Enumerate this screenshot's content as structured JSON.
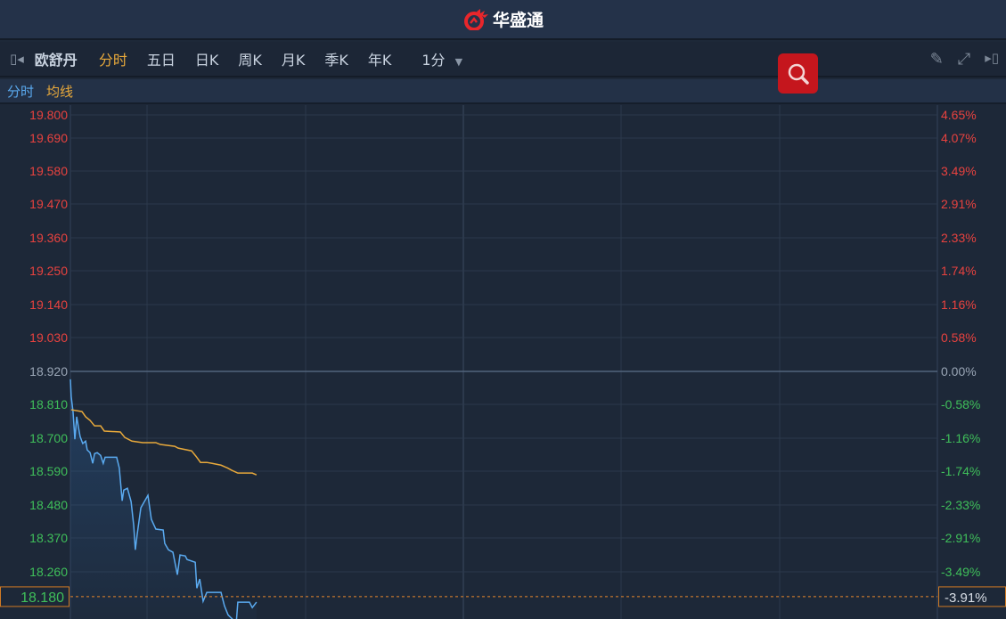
{
  "app": {
    "title": "华盛通"
  },
  "toolbar": {
    "stock_name": "欧舒丹",
    "tabs": [
      "分时",
      "五日",
      "日K",
      "周K",
      "月K",
      "季K",
      "年K"
    ],
    "active_tab": "分时",
    "interval": "1分"
  },
  "legend": {
    "price_label": "分时",
    "avg_label": "均线"
  },
  "colors": {
    "up": "#e8423f",
    "down": "#3fbf5a",
    "neutral": "#9aa6b6",
    "price_line": "#5aaaf0",
    "avg_line": "#e8a93b",
    "accent": "#c5161d"
  },
  "chart_data": {
    "type": "line",
    "prev_close": 18.92,
    "left_ticks": [
      "19.800",
      "19.690",
      "19.580",
      "19.470",
      "19.360",
      "19.250",
      "19.140",
      "19.030",
      "18.920",
      "18.810",
      "18.700",
      "18.590",
      "18.480",
      "18.370",
      "18.260"
    ],
    "right_ticks": [
      "4.65%",
      "4.07%",
      "3.49%",
      "2.91%",
      "2.33%",
      "1.74%",
      "1.16%",
      "0.58%",
      "0.00%",
      "-0.58%",
      "-1.16%",
      "-1.74%",
      "-2.33%",
      "-2.91%",
      "-3.49%"
    ],
    "current_price": "18.180",
    "current_change": "-3.91%",
    "current_value": 18.18,
    "series": [
      {
        "name": "分时",
        "t": [
          0,
          0.3,
          1,
          1.7,
          2.4,
          3.1,
          3.7,
          4.7,
          5.8,
          6.4,
          7.5,
          8.5,
          9.2,
          10.2,
          11.5,
          12.5,
          13.2,
          14.2,
          17.6,
          18.6,
          19.7,
          20.3,
          21.7,
          23.1,
          24.1,
          24.7,
          25.4,
          26.8,
          29.5,
          30.8,
          32.5,
          35.3,
          35.9,
          37.3,
          39,
          40.7,
          41.7,
          43.7,
          44.4,
          47.5,
          48.1,
          49.2,
          50.5,
          51.9,
          57.3,
          58.6,
          60,
          63.1,
          63.7,
          68.1,
          69.2,
          70.8
        ],
        "values": [
          18.894,
          18.838,
          18.788,
          18.697,
          18.771,
          18.735,
          18.706,
          18.683,
          18.691,
          18.662,
          18.653,
          18.618,
          18.65,
          18.653,
          18.644,
          18.618,
          18.638,
          18.638,
          18.638,
          18.603,
          18.495,
          18.53,
          18.536,
          18.492,
          18.413,
          18.334,
          18.384,
          18.472,
          18.513,
          18.434,
          18.402,
          18.399,
          18.355,
          18.334,
          18.326,
          18.252,
          18.317,
          18.314,
          18.302,
          18.293,
          18.208,
          18.238,
          18.165,
          18.194,
          18.194,
          18.15,
          18.12,
          18.094,
          18.162,
          18.162,
          18.144,
          18.162
        ]
      },
      {
        "name": "均线",
        "t": [
          0.3,
          4.4,
          5.8,
          7.5,
          9.2,
          11.5,
          12.9,
          19,
          20.7,
          23.4,
          27.5,
          32.5,
          34.2,
          39.7,
          41,
          46.1,
          47.8,
          49.5,
          51.9,
          53.9,
          57.3,
          59.7,
          61.4,
          63.7,
          69.2,
          70.8
        ],
        "values": [
          18.794,
          18.788,
          18.771,
          18.759,
          18.741,
          18.741,
          18.724,
          18.721,
          18.703,
          18.691,
          18.686,
          18.686,
          18.68,
          18.674,
          18.668,
          18.659,
          18.641,
          18.621,
          18.621,
          18.618,
          18.612,
          18.603,
          18.595,
          18.586,
          18.586,
          18.58
        ]
      }
    ]
  }
}
